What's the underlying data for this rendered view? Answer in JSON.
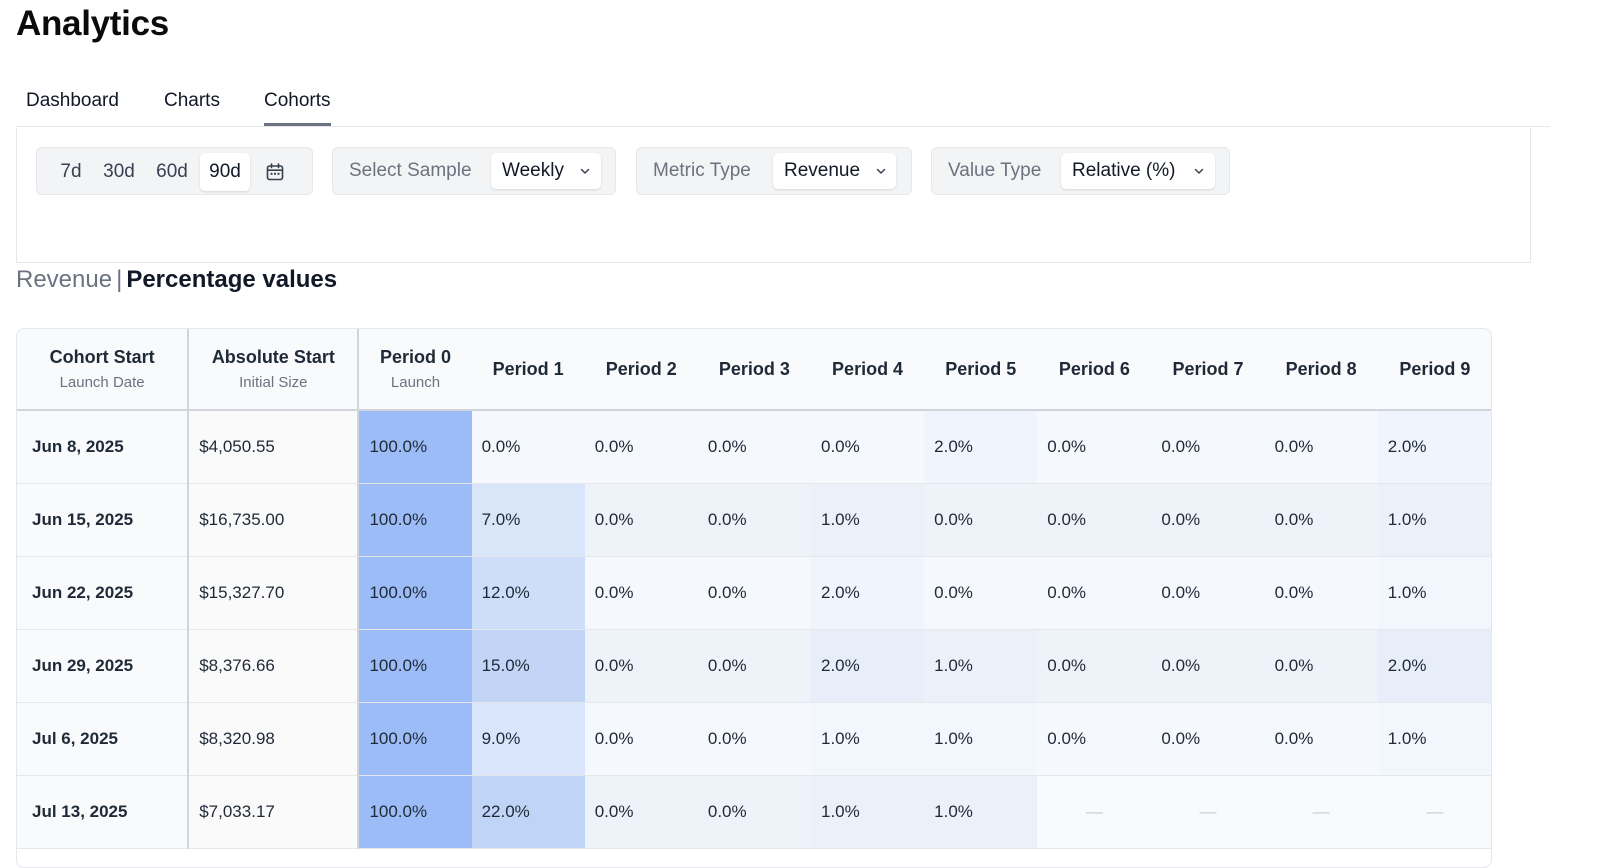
{
  "title": "Analytics",
  "tabs": [
    {
      "label": "Dashboard",
      "active": false
    },
    {
      "label": "Charts",
      "active": false
    },
    {
      "label": "Cohorts",
      "active": true
    }
  ],
  "filters": {
    "range_options": [
      "7d",
      "30d",
      "60d",
      "90d"
    ],
    "range_selected": "90d",
    "calendar_icon": "calendar-icon",
    "sample": {
      "label": "Select Sample",
      "value": "Weekly"
    },
    "metric": {
      "label": "Metric Type",
      "value": "Revenue"
    },
    "value_type": {
      "label": "Value Type",
      "value": "Relative (%)"
    }
  },
  "subtitle": {
    "metric": "Revenue",
    "separator": "|",
    "mode": "Percentage values"
  },
  "table": {
    "columns": [
      {
        "label": "Cohort Start",
        "sub": "Launch Date"
      },
      {
        "label": "Absolute Start",
        "sub": "Initial Size"
      },
      {
        "label": "Period 0",
        "sub": "Launch"
      },
      {
        "label": "Period 1",
        "sub": ""
      },
      {
        "label": "Period 2",
        "sub": ""
      },
      {
        "label": "Period 3",
        "sub": ""
      },
      {
        "label": "Period 4",
        "sub": ""
      },
      {
        "label": "Period 5",
        "sub": ""
      },
      {
        "label": "Period 6",
        "sub": ""
      },
      {
        "label": "Period 7",
        "sub": ""
      },
      {
        "label": "Period 8",
        "sub": ""
      },
      {
        "label": "Period 9",
        "sub": ""
      }
    ],
    "rows": [
      {
        "date": "Jun 8, 2025",
        "start": "$4,050.55",
        "values": [
          "100.0%",
          "0.0%",
          "0.0%",
          "0.0%",
          "0.0%",
          "2.0%",
          "0.0%",
          "0.0%",
          "0.0%",
          "2.0%"
        ]
      },
      {
        "date": "Jun 15, 2025",
        "start": "$16,735.00",
        "values": [
          "100.0%",
          "7.0%",
          "0.0%",
          "0.0%",
          "1.0%",
          "0.0%",
          "0.0%",
          "0.0%",
          "0.0%",
          "1.0%"
        ]
      },
      {
        "date": "Jun 22, 2025",
        "start": "$15,327.70",
        "values": [
          "100.0%",
          "12.0%",
          "0.0%",
          "0.0%",
          "2.0%",
          "0.0%",
          "0.0%",
          "0.0%",
          "0.0%",
          "1.0%"
        ]
      },
      {
        "date": "Jun 29, 2025",
        "start": "$8,376.66",
        "values": [
          "100.0%",
          "15.0%",
          "0.0%",
          "0.0%",
          "2.0%",
          "1.0%",
          "0.0%",
          "0.0%",
          "0.0%",
          "2.0%"
        ]
      },
      {
        "date": "Jul 6, 2025",
        "start": "$8,320.98",
        "values": [
          "100.0%",
          "9.0%",
          "0.0%",
          "0.0%",
          "1.0%",
          "1.0%",
          "0.0%",
          "0.0%",
          "0.0%",
          "1.0%"
        ]
      },
      {
        "date": "Jul 13, 2025",
        "start": "$7,033.17",
        "values": [
          "100.0%",
          "22.0%",
          "0.0%",
          "0.0%",
          "1.0%",
          "1.0%",
          "—",
          "—",
          "—",
          "—"
        ]
      }
    ]
  },
  "colors": {
    "heat_base_odd": "#f5f8fd",
    "heat_base_even": "#eef2f9",
    "heat_accent": "#9bbcf6",
    "empty_bg": "#f9fafb"
  }
}
